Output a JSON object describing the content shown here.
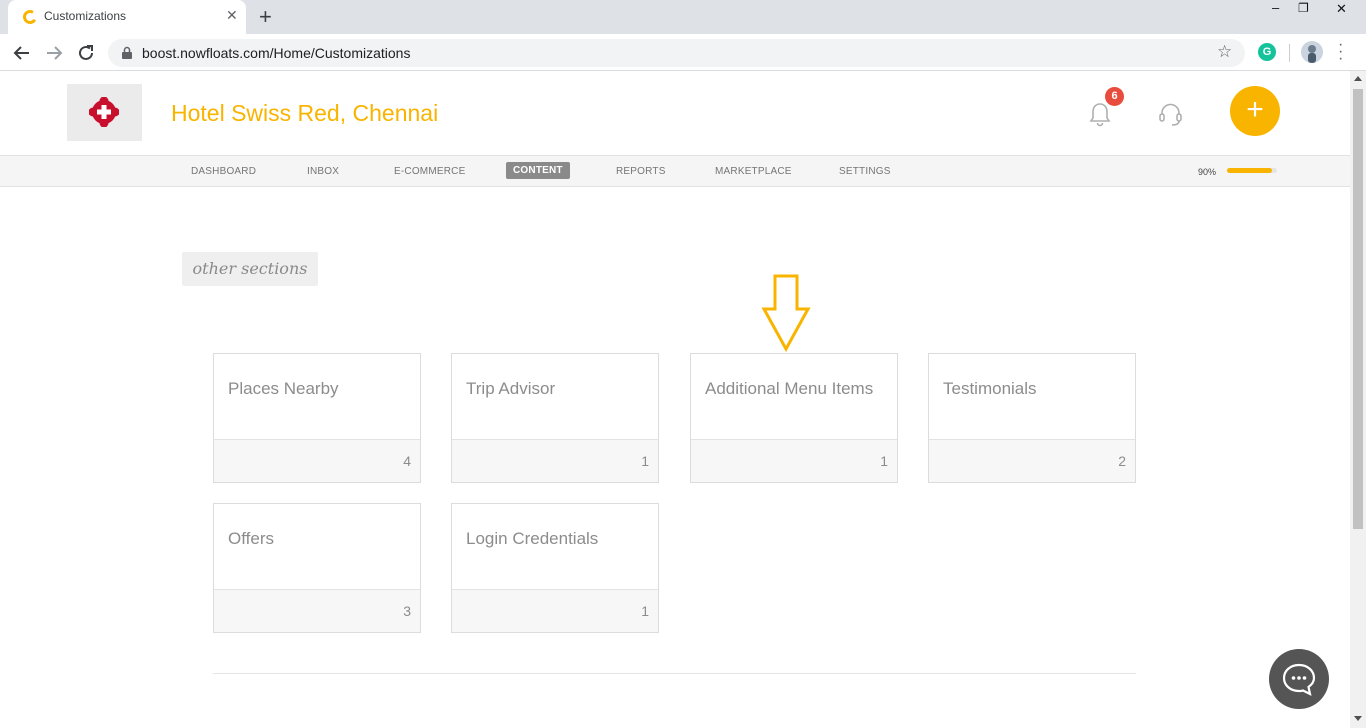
{
  "browser": {
    "tab_title": "Customizations",
    "url": "boost.nowfloats.com/Home/Customizations",
    "extension_letter": "G"
  },
  "header": {
    "business_name": "Hotel Swiss Red, Chennai",
    "notification_count": "6",
    "brand_color": "#f9b400"
  },
  "nav": {
    "items": [
      "DASHBOARD",
      "INBOX",
      "E-COMMERCE",
      "CONTENT",
      "REPORTS",
      "MARKETPLACE",
      "SETTINGS"
    ],
    "active": "CONTENT",
    "progress_label": "90%",
    "progress_value": 0.9
  },
  "main": {
    "section_label": "other sections",
    "cards": [
      {
        "title": "Places Nearby",
        "count": "4"
      },
      {
        "title": "Trip Advisor",
        "count": "1"
      },
      {
        "title": "Additional Menu Items",
        "count": "1"
      },
      {
        "title": "Testimonials",
        "count": "2"
      },
      {
        "title": "Offers",
        "count": "3"
      },
      {
        "title": "Login Credentials",
        "count": "1"
      }
    ]
  },
  "icons": {
    "tab_favicon": "nowfloats-c-icon",
    "close": "close-icon",
    "new_tab": "plus-icon",
    "back": "back-arrow-icon",
    "forward": "forward-arrow-icon",
    "reload": "reload-icon",
    "lock": "lock-icon",
    "bookmark": "star-icon",
    "bell": "bell-icon",
    "support": "headset-icon",
    "add": "plus-icon",
    "chat": "chat-icon",
    "arrow": "down-arrow-annotation-icon"
  }
}
